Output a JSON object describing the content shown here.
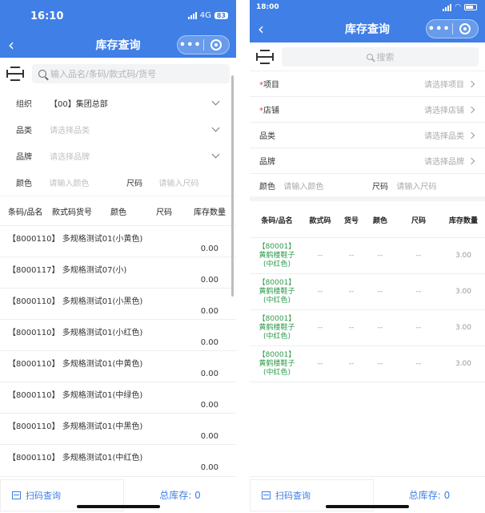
{
  "left": {
    "status": {
      "time": "16:10",
      "network": "4G",
      "battery": "83"
    },
    "title": "库存查询",
    "search_placeholder": "输入品名/条码/款式码/货号",
    "filters": {
      "org_label": "组织",
      "org_value": "【00】集团总部",
      "category_label": "品类",
      "category_placeholder": "请选择品类",
      "brand_label": "品牌",
      "brand_placeholder": "请选择品牌",
      "color_label": "颜色",
      "color_placeholder": "请输入颜色",
      "size_label": "尺码",
      "size_placeholder": "请输入尺码"
    },
    "columns": [
      "条码/品名",
      "款式码货号",
      "颜色",
      "尺码",
      "库存数量"
    ],
    "items": [
      {
        "name": "【8000110】 多规格测试01(小黄色)",
        "qty": "0.00"
      },
      {
        "name": "【8000117】 多规格测试07(小)",
        "qty": "0.00"
      },
      {
        "name": "【8000110】 多规格测试01(小黑色)",
        "qty": "0.00"
      },
      {
        "name": "【8000110】 多规格测试01(小红色)",
        "qty": "0.00"
      },
      {
        "name": "【8000110】 多规格测试01(中黄色)",
        "qty": "0.00"
      },
      {
        "name": "【8000110】 多规格测试01(中绿色)",
        "qty": "0.00"
      },
      {
        "name": "【8000110】 多规格测试01(中黑色)",
        "qty": "0.00"
      },
      {
        "name": "【8000110】 多规格测试01(中红色)",
        "qty": "0.00"
      }
    ],
    "footer": {
      "scan_label": "扫码查询",
      "total_label": "总库存:  0"
    }
  },
  "right": {
    "status": {
      "time": "18:00"
    },
    "title": "库存查询",
    "search_placeholder": "搜索",
    "filters": {
      "project_label": "项目",
      "project_placeholder": "请选择项目",
      "store_label": "店铺",
      "store_placeholder": "请选择店铺",
      "category_label": "品类",
      "category_placeholder": "请选择品类",
      "brand_label": "品牌",
      "brand_placeholder": "请选择品牌",
      "color_label": "颜色",
      "color_placeholder": "请输入颜色",
      "size_label": "尺码",
      "size_placeholder": "请输入尺码"
    },
    "columns": [
      "条码/品名",
      "款式码",
      "货号",
      "颜色",
      "尺码",
      "库存数量"
    ],
    "rows": [
      {
        "code": "【80001】",
        "name": "黄鹤楼鞋子",
        "spec": "(中红色)",
        "style": "--",
        "article": "--",
        "color": "--",
        "size": "--",
        "qty": "3.00"
      },
      {
        "code": "【80001】",
        "name": "黄鹤楼鞋子",
        "spec": "(中红色)",
        "style": "--",
        "article": "--",
        "color": "--",
        "size": "--",
        "qty": "3.00"
      },
      {
        "code": "【80001】",
        "name": "黄鹤楼鞋子",
        "spec": "(中红色)",
        "style": "--",
        "article": "--",
        "color": "--",
        "size": "--",
        "qty": "3.00"
      },
      {
        "code": "【80001】",
        "name": "黄鹤楼鞋子",
        "spec": "(中红色)",
        "style": "--",
        "article": "--",
        "color": "--",
        "size": "--",
        "qty": "3.00"
      }
    ],
    "footer": {
      "scan_label": "扫码查询",
      "total_label": "总库存:  0"
    }
  },
  "icons": {
    "back": "chevron-left-icon",
    "more": "more-dots-icon",
    "close": "target-circle-icon",
    "scan": "scan-icon",
    "search": "search-icon",
    "dropdown": "chevron-down-icon",
    "arrow": "chevron-right-icon"
  },
  "colors": {
    "primary": "#3f7fe6",
    "product_green": "#2e9a4b",
    "required": "#e03c3c"
  }
}
